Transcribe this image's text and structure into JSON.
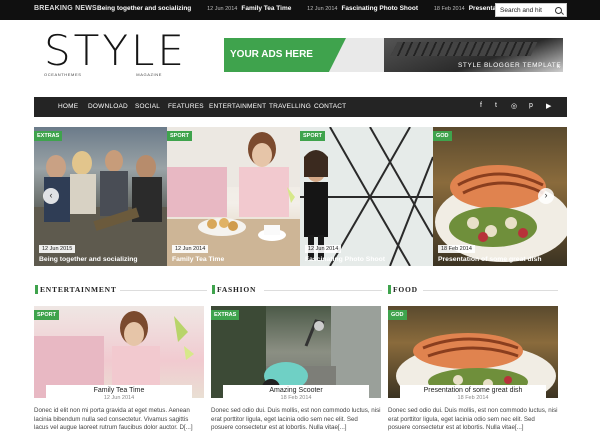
{
  "topbar": {
    "label": "BREAKING NEWS",
    "ticker": [
      {
        "date": "",
        "title": "Being together and socializing"
      },
      {
        "date": "12 Jun 2014",
        "title": "Family Tea Time"
      },
      {
        "date": "12 Jun 2014",
        "title": "Fascinating Photo Shoot"
      },
      {
        "date": "18 Feb 2014",
        "title": "Presentation of some grea"
      }
    ],
    "search_placeholder": "Search and hit"
  },
  "logo": {
    "main": "STYLE",
    "sub_left": "OCEANTHEMES",
    "sub_right": "MAGAZINE"
  },
  "ad": {
    "headline": "YOUR ADS HERE",
    "tagline": "STYLE BLOGGER TEMPLATE",
    "close": "x"
  },
  "nav": {
    "items": [
      "HOME",
      "DOWNLOAD",
      "SOCIAL",
      "FEATURES",
      "ENTERTAINMENT",
      "TRAVELLING",
      "CONTACT"
    ],
    "social": [
      "f",
      "t",
      "◎",
      "p",
      "▶"
    ]
  },
  "slider": [
    {
      "category": "EXTRAS",
      "date": "12 Jun 2015",
      "title": "Being together and socializing"
    },
    {
      "category": "SPORT",
      "date": "12 Jun 2014",
      "title": "Family Tea Time"
    },
    {
      "category": "SPORT",
      "date": "12 Jun 2014",
      "title": "Fascinating Photo Shoot"
    },
    {
      "category": "GOD",
      "date": "18 Feb 2014",
      "title": "Presentation of some great dish"
    }
  ],
  "sections": [
    {
      "heading": "ENTERTAINMENT",
      "card": {
        "category": "SPORT",
        "title": "Family Tea Time",
        "date": "12 Jun 2014",
        "excerpt": "Donec id elit non mi porta gravida at eget metus. Aenean lacinia bibendum nulla sed consectetur. Vivamus sagittis lacus vel augue laoreet rutrum faucibus dolor auctor. D[...]"
      }
    },
    {
      "heading": "FASHION",
      "card": {
        "category": "EXTRAS",
        "title": "Amazing Scooter",
        "date": "18 Feb 2014",
        "excerpt": "Donec sed odio dui. Duis mollis, est non commodo luctus, nisi erat porttitor ligula, eget lacinia odio sem nec elit. Sed posuere consectetur est at lobortis. Nulla vitae[...]"
      }
    },
    {
      "heading": "FOOD",
      "card": {
        "category": "GOD",
        "title": "Presentation of some great dish",
        "date": "18 Feb 2014",
        "excerpt": "Donec sed odio dui. Duis mollis, est non commodo luctus, nisi erat porttitor ligula, eget lacinia odio sem nec elit. Sed posuere consectetur est at lobortis. Nulla vitae[...]"
      }
    }
  ],
  "colors": {
    "accent": "#3fa34d",
    "topbar": "#101010",
    "nav": "#242424"
  }
}
